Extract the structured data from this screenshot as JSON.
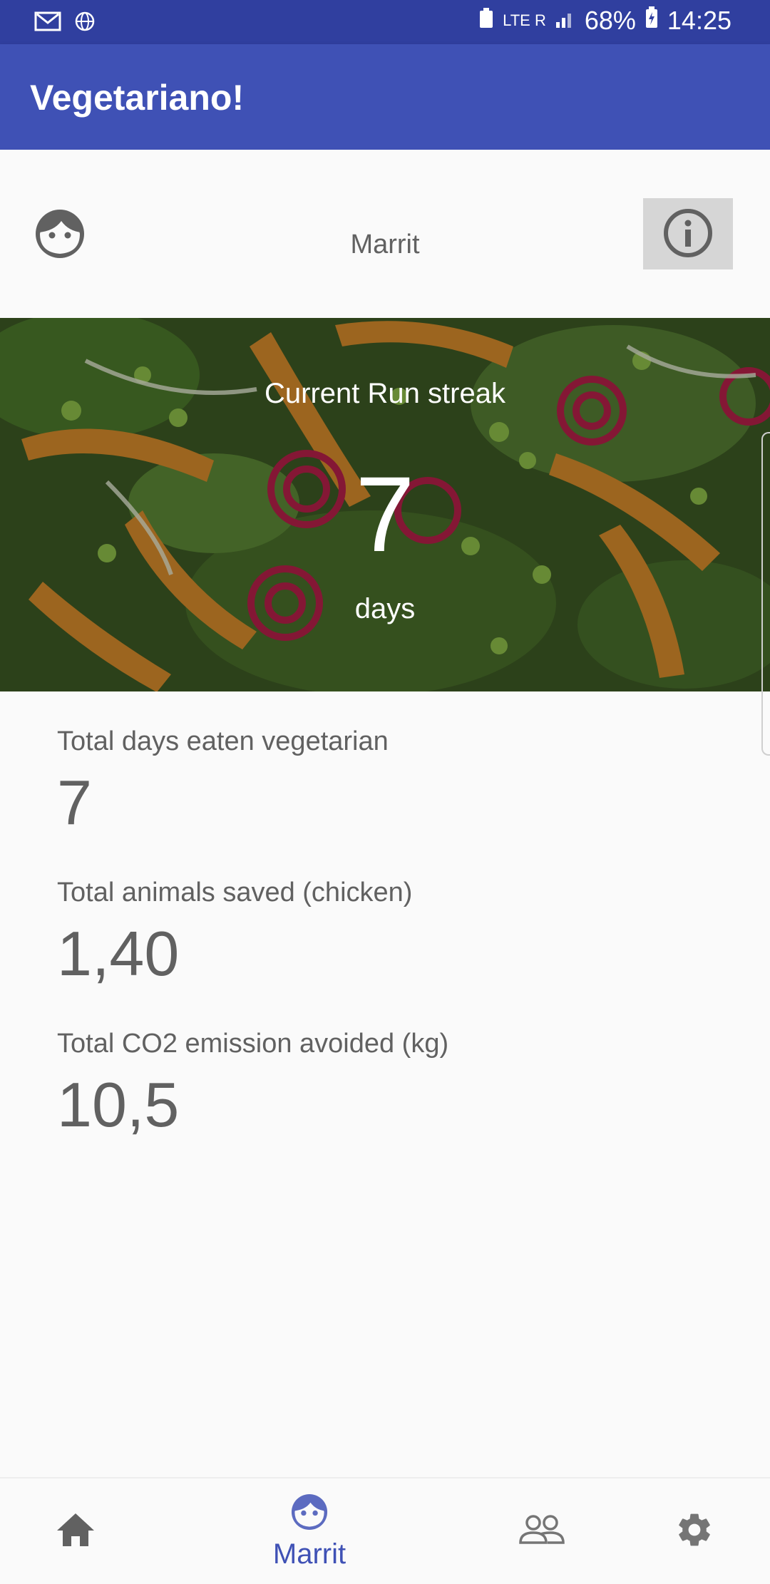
{
  "status_bar": {
    "network": "LTE R",
    "battery": "68%",
    "time": "14:25"
  },
  "app_bar": {
    "title": "Vegetariano!"
  },
  "profile": {
    "name": "Marrit"
  },
  "streak": {
    "label": "Current Run streak",
    "value": "7",
    "unit": "days"
  },
  "stats": [
    {
      "label": "Total days eaten vegetarian",
      "value": "7"
    },
    {
      "label": "Total animals saved (chicken)",
      "value": "1,40"
    },
    {
      "label": "Total CO2 emission avoided (kg)",
      "value": "10,5"
    }
  ],
  "bottom_nav": {
    "items": [
      {
        "icon": "home-icon",
        "label": ""
      },
      {
        "icon": "face-icon",
        "label": "Marrit"
      },
      {
        "icon": "people-icon",
        "label": ""
      },
      {
        "icon": "gear-icon",
        "label": ""
      }
    ],
    "active_index": 1
  },
  "colors": {
    "primary": "#3f51b5",
    "primary_dark": "#303f9f",
    "text": "#616161",
    "background": "#fafafa"
  }
}
